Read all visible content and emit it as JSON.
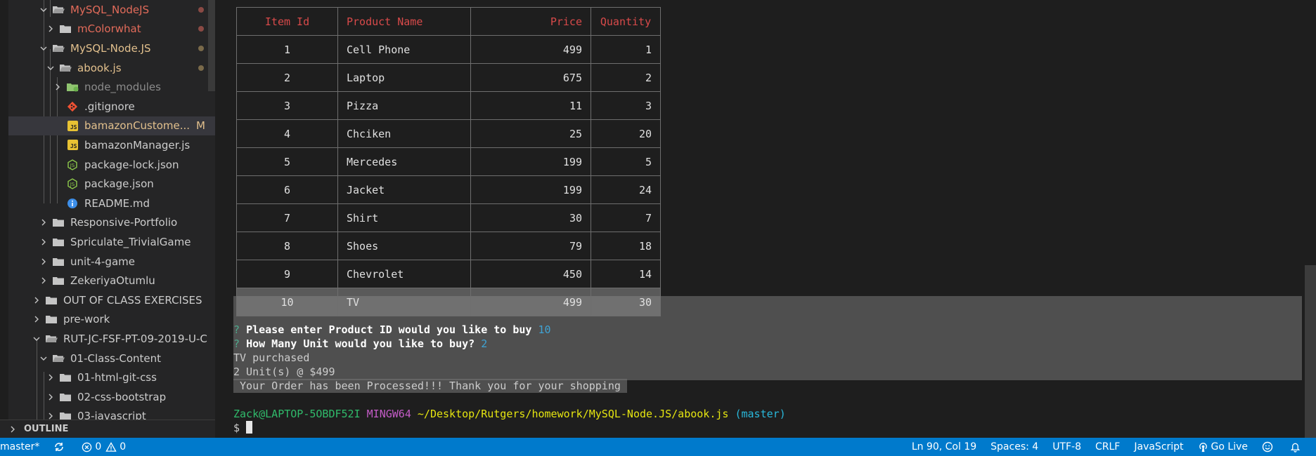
{
  "sidebar": {
    "items": [
      {
        "label": "MySQL_NodeJS",
        "color": "#e26b5a"
      },
      {
        "label": "mColorwhat",
        "color": "#e26b5a"
      },
      {
        "label": "MySQL-Node.JS",
        "color": "#e2c08d"
      },
      {
        "label": "abook.js",
        "color": "#e2c08d"
      },
      {
        "label": "node_modules",
        "color": "#8b8b8b"
      },
      {
        "label": ".gitignore",
        "color": "#cccccc"
      },
      {
        "label": "bamazonCustome...",
        "color": "#e2c08d",
        "badge": "M"
      },
      {
        "label": "bamazonManager.js",
        "color": "#cccccc"
      },
      {
        "label": "package-lock.json",
        "color": "#cccccc"
      },
      {
        "label": "package.json",
        "color": "#cccccc"
      },
      {
        "label": "README.md",
        "color": "#cccccc"
      },
      {
        "label": "Responsive-Portfolio",
        "color": "#cccccc"
      },
      {
        "label": "Spriculate_TrivialGame",
        "color": "#cccccc"
      },
      {
        "label": "unit-4-game",
        "color": "#cccccc"
      },
      {
        "label": "ZekeriyaOtumlu",
        "color": "#cccccc"
      },
      {
        "label": "OUT OF CLASS EXERCISES",
        "color": "#cccccc"
      },
      {
        "label": "pre-work",
        "color": "#cccccc"
      },
      {
        "label": "RUT-JC-FSF-PT-09-2019-U-C",
        "color": "#cccccc"
      },
      {
        "label": "01-Class-Content",
        "color": "#cccccc"
      },
      {
        "label": "01-html-git-css",
        "color": "#cccccc"
      },
      {
        "label": "02-css-bootstrap",
        "color": "#cccccc"
      },
      {
        "label": "03-javascript",
        "color": "#cccccc"
      }
    ],
    "outline_label": "OUTLINE"
  },
  "terminal": {
    "table": {
      "headers": [
        "Item Id",
        "Product Name",
        "Price",
        "Quantity"
      ],
      "rows": [
        [
          "1",
          "Cell Phone",
          "499",
          "1"
        ],
        [
          "2",
          "Laptop",
          "675",
          "2"
        ],
        [
          "3",
          "Pizza",
          "11",
          "3"
        ],
        [
          "4",
          "Chciken",
          "25",
          "20"
        ],
        [
          "5",
          "Mercedes",
          "199",
          "5"
        ],
        [
          "6",
          "Jacket",
          "199",
          "24"
        ],
        [
          "7",
          "Shirt",
          "30",
          "7"
        ],
        [
          "8",
          "Shoes",
          "79",
          "18"
        ],
        [
          "9",
          "Chevrolet",
          "450",
          "14"
        ],
        [
          "10",
          "TV",
          "499",
          "30"
        ]
      ]
    },
    "prompt1": {
      "mark": "?",
      "text": "Please enter Product ID would you like to buy",
      "answer": "10"
    },
    "prompt2": {
      "mark": "?",
      "text": "How Many Unit would you like to buy?",
      "answer": "2"
    },
    "out1": "TV purchased",
    "out2": "2 Unit(s) @ $499",
    "out3": " Your Order has been Processed!!! Thank you for your shopping ",
    "ps1": {
      "user_host": "Zack@LAPTOP-5OBDF52I",
      "shell": "MINGW64",
      "path": "~/Desktop/Rutgers/homework/MySQL-Node.JS/abook.js",
      "branch": "(master)"
    },
    "prompt_symbol": "$"
  },
  "statusbar": {
    "branch": "master*",
    "errors": "0",
    "warnings": "0",
    "position": "Ln 90, Col 19",
    "spaces": "Spaces: 4",
    "encoding": "UTF-8",
    "eol": "CRLF",
    "language": "JavaScript",
    "golive": "Go Live"
  },
  "colors": {
    "statusbar_bg": "#007acc",
    "header_red": "#d84a4a",
    "folder_grey": "#c5c5c5"
  }
}
